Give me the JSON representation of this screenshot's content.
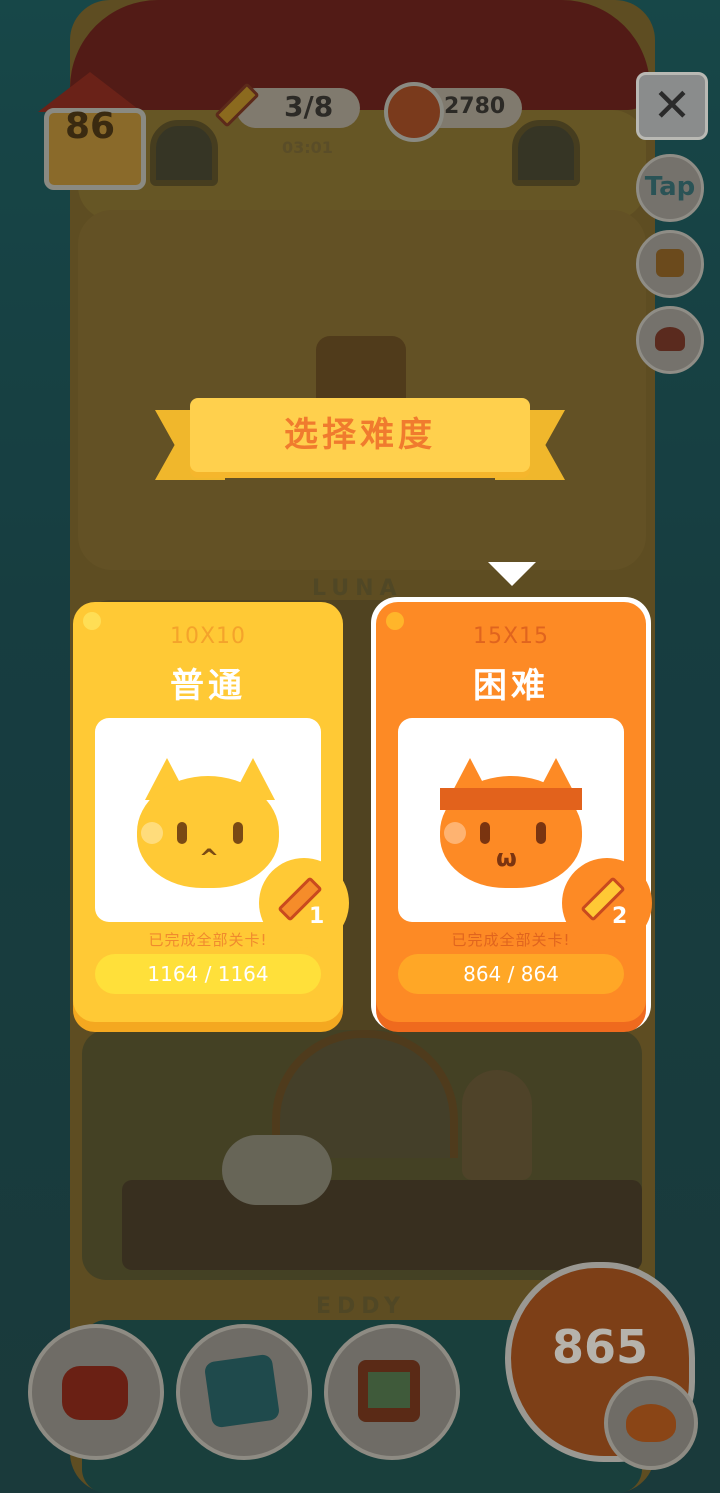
{
  "background": {
    "floor_labels": [
      "LUNA",
      "EDDY"
    ]
  },
  "topbar": {
    "house_level": "86",
    "pencils": "3/8",
    "timer": "03:01",
    "coins": "2780",
    "tap_label": "Tap"
  },
  "dialog": {
    "title": "选择难度",
    "options": [
      {
        "size": "10X10",
        "name": "普通",
        "completed_text": "已完成全部关卡!",
        "progress": "1164 / 1164",
        "pencil_cost": "1",
        "selected": false
      },
      {
        "size": "15X15",
        "name": "困难",
        "completed_text": "已完成全部关卡!",
        "progress": "864 / 864",
        "pencil_cost": "2",
        "selected": true
      }
    ]
  },
  "bottombar": {
    "buttons": [
      "armchair-icon",
      "book-icon",
      "picture-frame-icon"
    ],
    "level_count": "865"
  },
  "colors": {
    "normal_card": "#ffc935",
    "hard_card": "#fd8a25",
    "ribbon": "#ffd04d",
    "title_text": "#f07b2e"
  }
}
